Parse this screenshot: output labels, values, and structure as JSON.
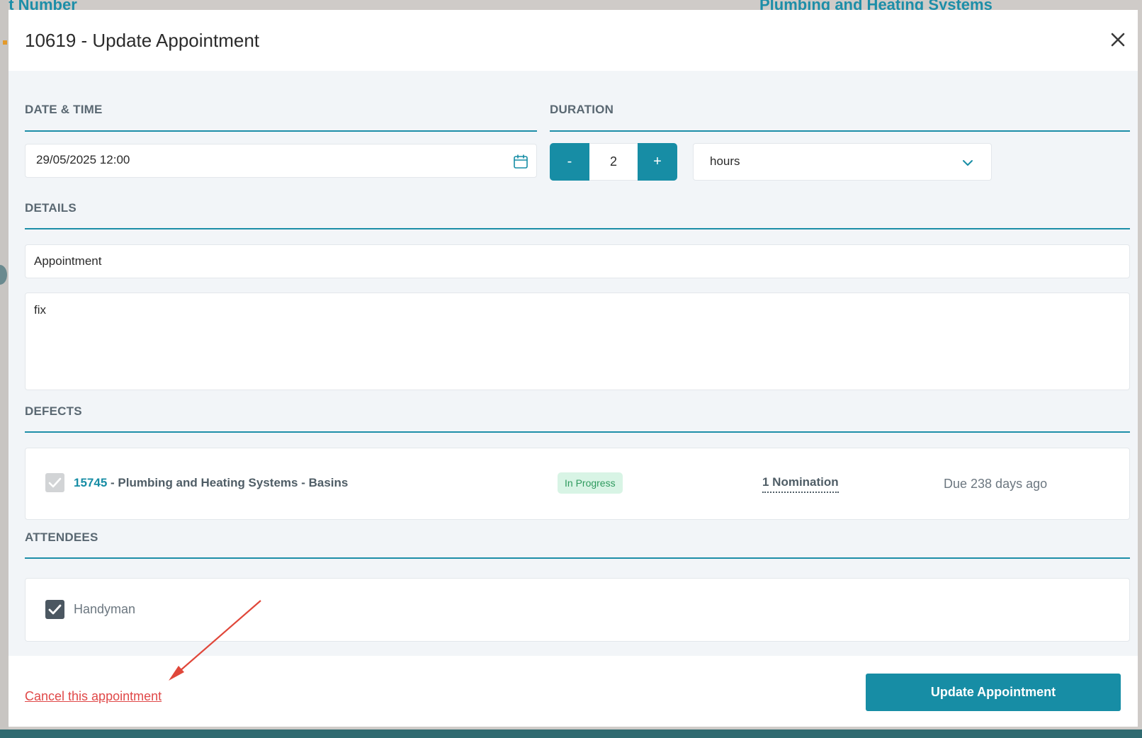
{
  "background": {
    "left_heading": "ct Number",
    "right_heading": "Plumbing and Heating Systems"
  },
  "modal": {
    "title": "10619 - Update Appointment",
    "close_icon": "close-icon"
  },
  "date_time": {
    "label": "DATE & TIME",
    "value": "29/05/2025 12:00",
    "icon": "calendar-icon"
  },
  "duration": {
    "label": "DURATION",
    "minus_label": "-",
    "value": "2",
    "plus_label": "+",
    "unit": "hours",
    "unit_icon": "chevron-down-icon"
  },
  "details": {
    "label": "DETAILS",
    "subject": "Appointment",
    "notes": "fix"
  },
  "defects": {
    "label": "DEFECTS",
    "items": [
      {
        "id": "15745",
        "description": " - Plumbing and Heating Systems - Basins",
        "status": "In Progress",
        "nominations": "1 Nomination",
        "due": "Due 238 days ago"
      }
    ]
  },
  "attendees": {
    "label": "ATTENDEES",
    "items": [
      {
        "name": "Handyman",
        "checked": true
      }
    ]
  },
  "footer": {
    "cancel_label": "Cancel this appointment",
    "update_label": "Update Appointment"
  },
  "colors": {
    "accent": "#178da5",
    "danger": "#e04848",
    "status_bg": "#d8f4e5",
    "status_text": "#2e9a5e",
    "annotation_arrow": "#e0473a"
  }
}
